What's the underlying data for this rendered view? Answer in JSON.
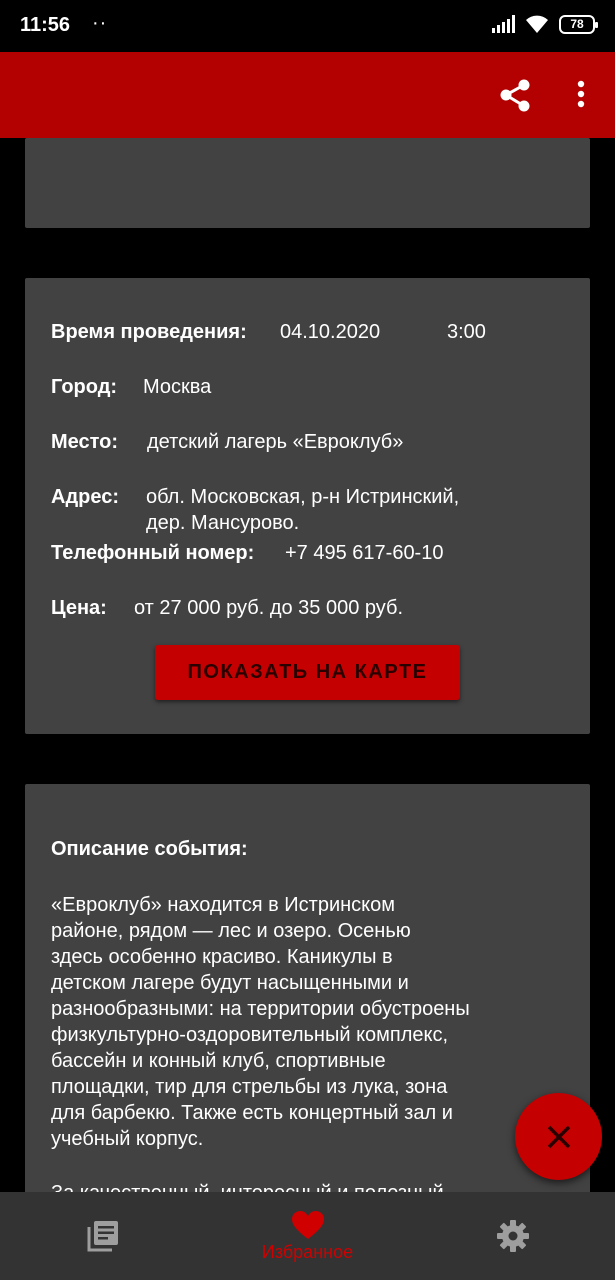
{
  "status_bar": {
    "time": "11:56",
    "dots": "··",
    "battery": "78",
    "icons": [
      "signal-icon",
      "wifi-icon",
      "battery-icon"
    ]
  },
  "app_bar": {
    "color": "#b30000",
    "actions": [
      "share-icon",
      "more-vert-icon"
    ]
  },
  "event": {
    "time_label": "Время проведения:",
    "date": "04.10.2020",
    "time": "3:00",
    "city_label": "Город:",
    "city": "Москва",
    "place_label": "Место:",
    "place": "детский лагерь «Евроклуб»",
    "address_label": "Адрес:",
    "address_line1": "обл. Московская, р-н Истринский,",
    "address_line2": "дер. Мансурово.",
    "phone_label": "Телефонный номер:",
    "phone": "+7 495 617-60-10",
    "price_label": "Цена:",
    "price": "от 27 000 руб. до 35 000 руб.",
    "map_button": "ПОКАЗАТЬ НА КАРТЕ"
  },
  "description": {
    "title": "Описание события:",
    "text": "«Евроклуб» находится в Истринском\nрайоне, рядом — лес и озеро. Осенью\nздесь особенно красиво. Каникулы в\nдетском лагере будут насыщенными и\nразнообразными: на территории обустроены\nфизкультурно-оздоровительный комплекс,\nбассейн и конный клуб, спортивные\nплощадки, тир для стрельбы из лука, зона\nдля барбекю. Также есть концертный зал и\nучебный корпус.",
    "tail": "За качественный, интересный и полезный"
  },
  "fab": {
    "icon": "close-icon",
    "color": "#c40000"
  },
  "bottom_nav": {
    "items": [
      {
        "icon": "library-books-icon",
        "label": ""
      },
      {
        "icon": "heart-icon",
        "label": "Избранное"
      },
      {
        "icon": "gear-icon",
        "label": ""
      }
    ],
    "active_color": "#d00000"
  }
}
